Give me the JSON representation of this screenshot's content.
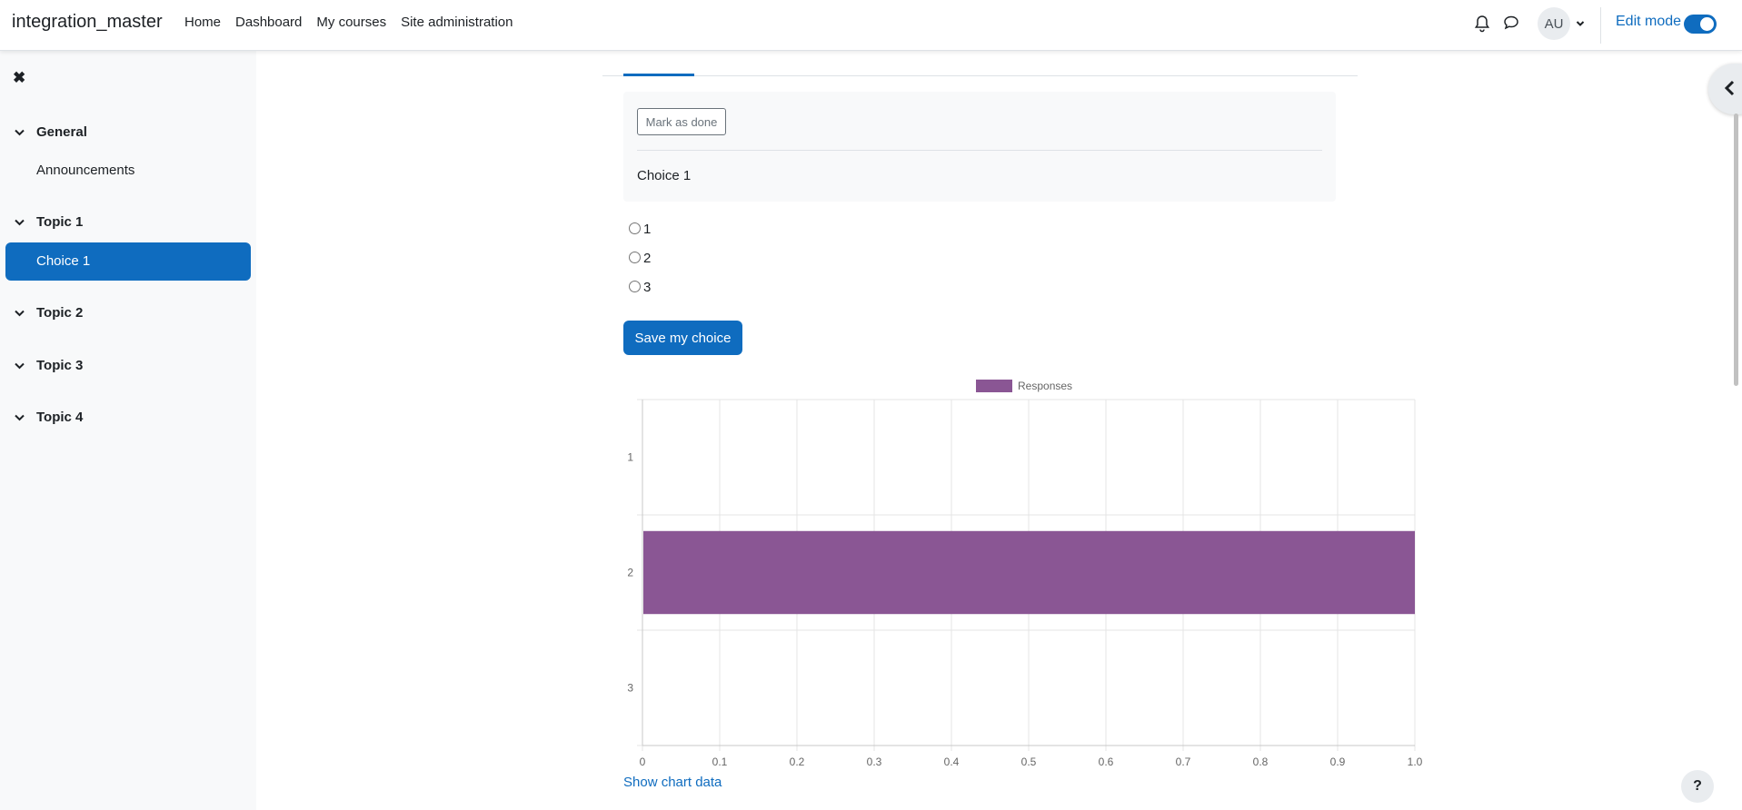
{
  "navbar": {
    "brand": "integration_master",
    "links": [
      "Home",
      "Dashboard",
      "My courses",
      "Site administration"
    ],
    "avatar": "AU",
    "edit_mode_label": "Edit mode",
    "edit_mode_on": true
  },
  "sidebar": {
    "sections": [
      {
        "label": "General",
        "items": [
          "Announcements"
        ]
      },
      {
        "label": "Topic 1",
        "items": [
          "Choice 1"
        ]
      },
      {
        "label": "Topic 2",
        "items": []
      },
      {
        "label": "Topic 3",
        "items": []
      },
      {
        "label": "Topic 4",
        "items": []
      }
    ],
    "active_item": "Choice 1"
  },
  "activity": {
    "mark_done_label": "Mark as done",
    "title": "Choice 1",
    "options": [
      "1",
      "2",
      "3"
    ],
    "save_label": "Save my choice",
    "show_chart_data_label": "Show chart data"
  },
  "chart_data": {
    "type": "bar",
    "orientation": "horizontal",
    "categories": [
      "1",
      "2",
      "3"
    ],
    "series": [
      {
        "name": "Responses",
        "values": [
          0,
          1,
          0
        ],
        "color": "#8a5694"
      }
    ],
    "xlim": [
      0,
      1.0
    ],
    "x_ticks": [
      "0",
      "0.1",
      "0.2",
      "0.3",
      "0.4",
      "0.5",
      "0.6",
      "0.7",
      "0.8",
      "0.9",
      "1.0"
    ],
    "grid": true,
    "legend_position": "top"
  },
  "help": "?"
}
